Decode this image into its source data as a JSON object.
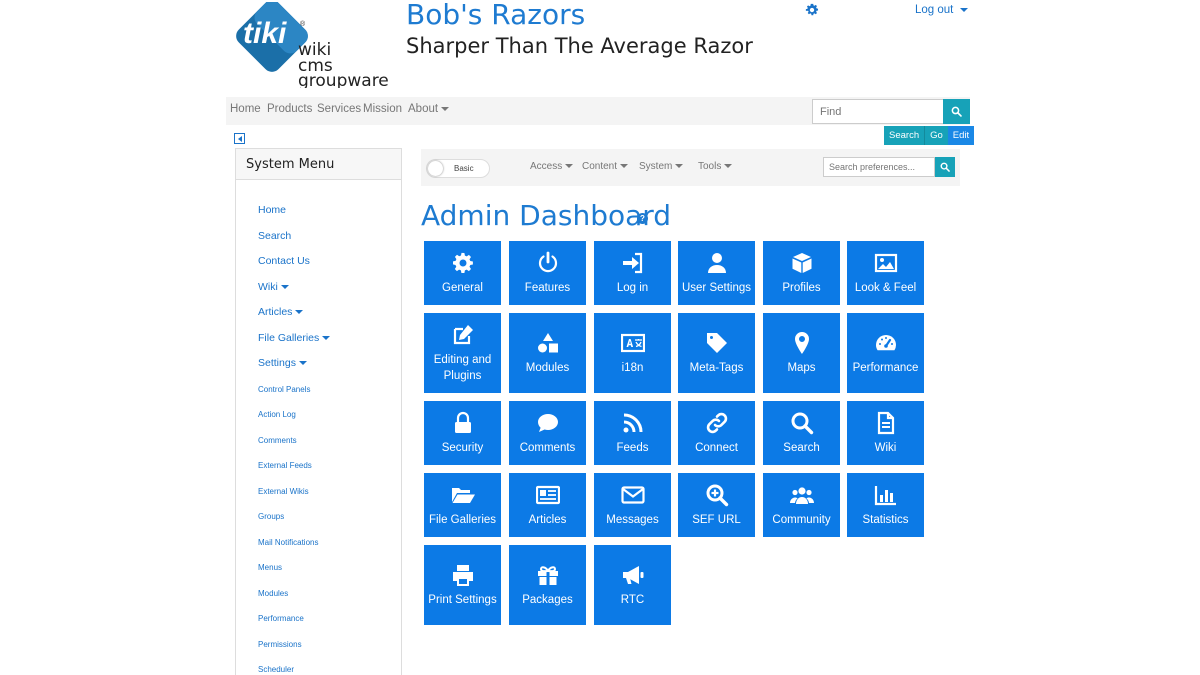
{
  "header": {
    "logo_text": "tiki wiki cms groupware",
    "site_title": "Bob's Razors",
    "site_subtitle": "Sharper Than The Average Razor",
    "logout_label": "Log out"
  },
  "topnav": {
    "items": [
      "Home",
      "Products",
      "Services",
      "Mission",
      "About"
    ],
    "find_placeholder": "Find",
    "buttons": [
      "Search",
      "Go",
      "Edit"
    ]
  },
  "sidebar": {
    "title": "System Menu",
    "items": [
      {
        "label": "Home"
      },
      {
        "label": "Search"
      },
      {
        "label": "Contact Us"
      },
      {
        "label": "Wiki"
      },
      {
        "label": "Articles"
      },
      {
        "label": "File Galleries"
      },
      {
        "label": "Settings"
      },
      {
        "label": "Control Panels"
      },
      {
        "label": "Action Log"
      },
      {
        "label": "Comments"
      },
      {
        "label": "External Feeds"
      },
      {
        "label": "External Wikis"
      },
      {
        "label": "Groups"
      },
      {
        "label": "Mail Notifications"
      },
      {
        "label": "Menus"
      },
      {
        "label": "Modules"
      },
      {
        "label": "Performance"
      },
      {
        "label": "Permissions"
      },
      {
        "label": "Scheduler"
      }
    ]
  },
  "admin_toolbar": {
    "toggle_label": "Basic",
    "menus": [
      "Access",
      "Content",
      "System",
      "Tools"
    ],
    "search_placeholder": "Search preferences..."
  },
  "dashboard": {
    "title": "Admin Dashboard",
    "help_icon": "question-circle-icon",
    "tiles": [
      {
        "label": "General",
        "icon": "gear-icon"
      },
      {
        "label": "Features",
        "icon": "power-icon"
      },
      {
        "label": "Log in",
        "icon": "sign-in-icon"
      },
      {
        "label": "User Settings",
        "icon": "user-icon"
      },
      {
        "label": "Profiles",
        "icon": "cube-icon"
      },
      {
        "label": "Look & Feel",
        "icon": "image-icon"
      },
      {
        "label": "Editing and Plugins",
        "icon": "edit-icon"
      },
      {
        "label": "Modules",
        "icon": "shapes-icon"
      },
      {
        "label": "i18n",
        "icon": "language-icon"
      },
      {
        "label": "Meta-Tags",
        "icon": "tag-icon"
      },
      {
        "label": "Maps",
        "icon": "map-marker-icon"
      },
      {
        "label": "Performance",
        "icon": "tachometer-icon"
      },
      {
        "label": "Security",
        "icon": "lock-icon"
      },
      {
        "label": "Comments",
        "icon": "comment-icon"
      },
      {
        "label": "Feeds",
        "icon": "rss-icon"
      },
      {
        "label": "Connect",
        "icon": "link-icon"
      },
      {
        "label": "Search",
        "icon": "search-icon"
      },
      {
        "label": "Wiki",
        "icon": "file-text-icon"
      },
      {
        "label": "File Galleries",
        "icon": "folder-open-icon"
      },
      {
        "label": "Articles",
        "icon": "newspaper-icon"
      },
      {
        "label": "Messages",
        "icon": "envelope-icon"
      },
      {
        "label": "SEF URL",
        "icon": "search-plus-icon"
      },
      {
        "label": "Community",
        "icon": "users-icon"
      },
      {
        "label": "Statistics",
        "icon": "bar-chart-icon"
      },
      {
        "label": "Print Settings",
        "icon": "print-icon"
      },
      {
        "label": "Packages",
        "icon": "gift-icon"
      },
      {
        "label": "RTC",
        "icon": "bullhorn-icon"
      }
    ]
  },
  "colors": {
    "accent": "#1e7bd1",
    "tile": "#0c7ae6",
    "teal": "#17a2b8",
    "edit_button": "#1a88e6",
    "logo": "#1b6fa8"
  }
}
